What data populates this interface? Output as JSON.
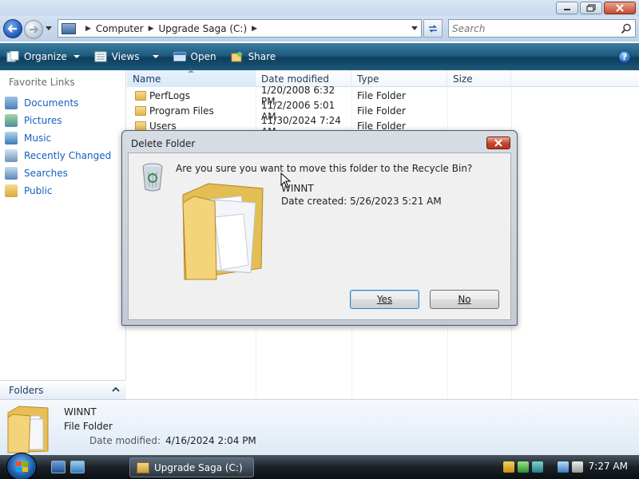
{
  "address_bar": {
    "crumbs": [
      "Computer",
      "Upgrade Saga (C:)"
    ],
    "search_placeholder": "Search"
  },
  "toolbar": {
    "organize": "Organize",
    "views": "Views",
    "open": "Open",
    "share": "Share",
    "help": "?"
  },
  "nav_pane": {
    "heading": "Favorite Links",
    "items": [
      {
        "label": "Documents",
        "icon": "documents-icon"
      },
      {
        "label": "Pictures",
        "icon": "pictures-icon"
      },
      {
        "label": "Music",
        "icon": "music-icon"
      },
      {
        "label": "Recently Changed",
        "icon": "recently-changed-icon"
      },
      {
        "label": "Searches",
        "icon": "searches-icon"
      },
      {
        "label": "Public",
        "icon": "public-folder-icon"
      }
    ],
    "folders_label": "Folders"
  },
  "file_list": {
    "columns": [
      "Name",
      "Date modified",
      "Type",
      "Size"
    ],
    "rows": [
      {
        "name": "PerfLogs",
        "date": "1/20/2008 6:32 PM",
        "type": "File Folder"
      },
      {
        "name": "Program Files",
        "date": "11/2/2006 5:01 AM",
        "type": "File Folder"
      },
      {
        "name": "Users",
        "date": "11/30/2024 7:24 AM",
        "type": "File Folder"
      }
    ]
  },
  "details_pane": {
    "name": "WINNT",
    "type": "File Folder",
    "date_label": "Date modified:",
    "date_value": "4/16/2024 2:04 PM"
  },
  "dialog": {
    "title": "Delete Folder",
    "question": "Are you sure you want to move this folder to the Recycle Bin?",
    "folder_name": "WINNT",
    "date_created": "Date created: 5/26/2023 5:21 AM",
    "yes_label": "Yes",
    "no_label": "No"
  },
  "taskbar": {
    "task_button": "Upgrade Saga (C:)",
    "clock": "7:27 AM"
  },
  "colors": {
    "toolbar": "#1d5a7e",
    "link": "#1560bd",
    "close_button": "#c2452b"
  }
}
